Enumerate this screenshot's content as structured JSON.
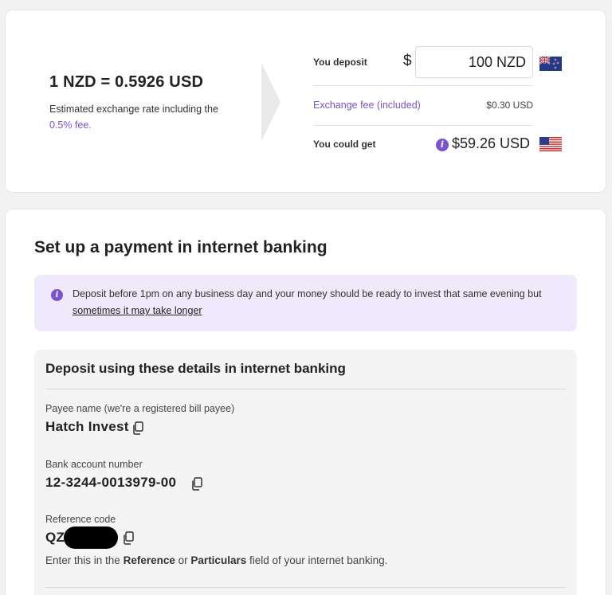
{
  "rate": {
    "title": "1 NZD = 0.5926 USD",
    "subtitle": "Estimated exchange rate including the",
    "fee_link": "0.5% fee."
  },
  "converter": {
    "deposit_label": "You deposit",
    "currency_symbol": "$",
    "deposit_value": "100 NZD",
    "fee_label": "Exchange fee (included)",
    "fee_value": "$0.30 USD",
    "get_label": "You could get",
    "get_value": "$59.26 USD"
  },
  "main": {
    "title": "Set up a payment in internet banking",
    "notice_text": "Deposit before 1pm on any business day and your money should be ready to invest that same evening but",
    "notice_link": "sometimes it may take longer"
  },
  "details": {
    "title": "Deposit using these details in internet banking",
    "payee_label": "Payee name (we're a registered bill payee)",
    "payee_value": "Hatch Invest",
    "account_label": "Bank account number",
    "account_value": "12-3244-0013979-00",
    "reference_label": "Reference code",
    "reference_value": "QZ",
    "help_prefix": "Enter this in the",
    "help_ref": "Reference",
    "help_or": "or",
    "help_particulars": "Particulars",
    "help_suffix": "field of your internet banking."
  },
  "colors": {
    "accent": "#7b52d6",
    "notice_bg": "#efe9fb",
    "details_bg": "#f4f4f4"
  },
  "icons": [
    "chevron-right-icon",
    "nz-flag-icon",
    "us-flag-icon",
    "info-icon",
    "copy-icon"
  ]
}
